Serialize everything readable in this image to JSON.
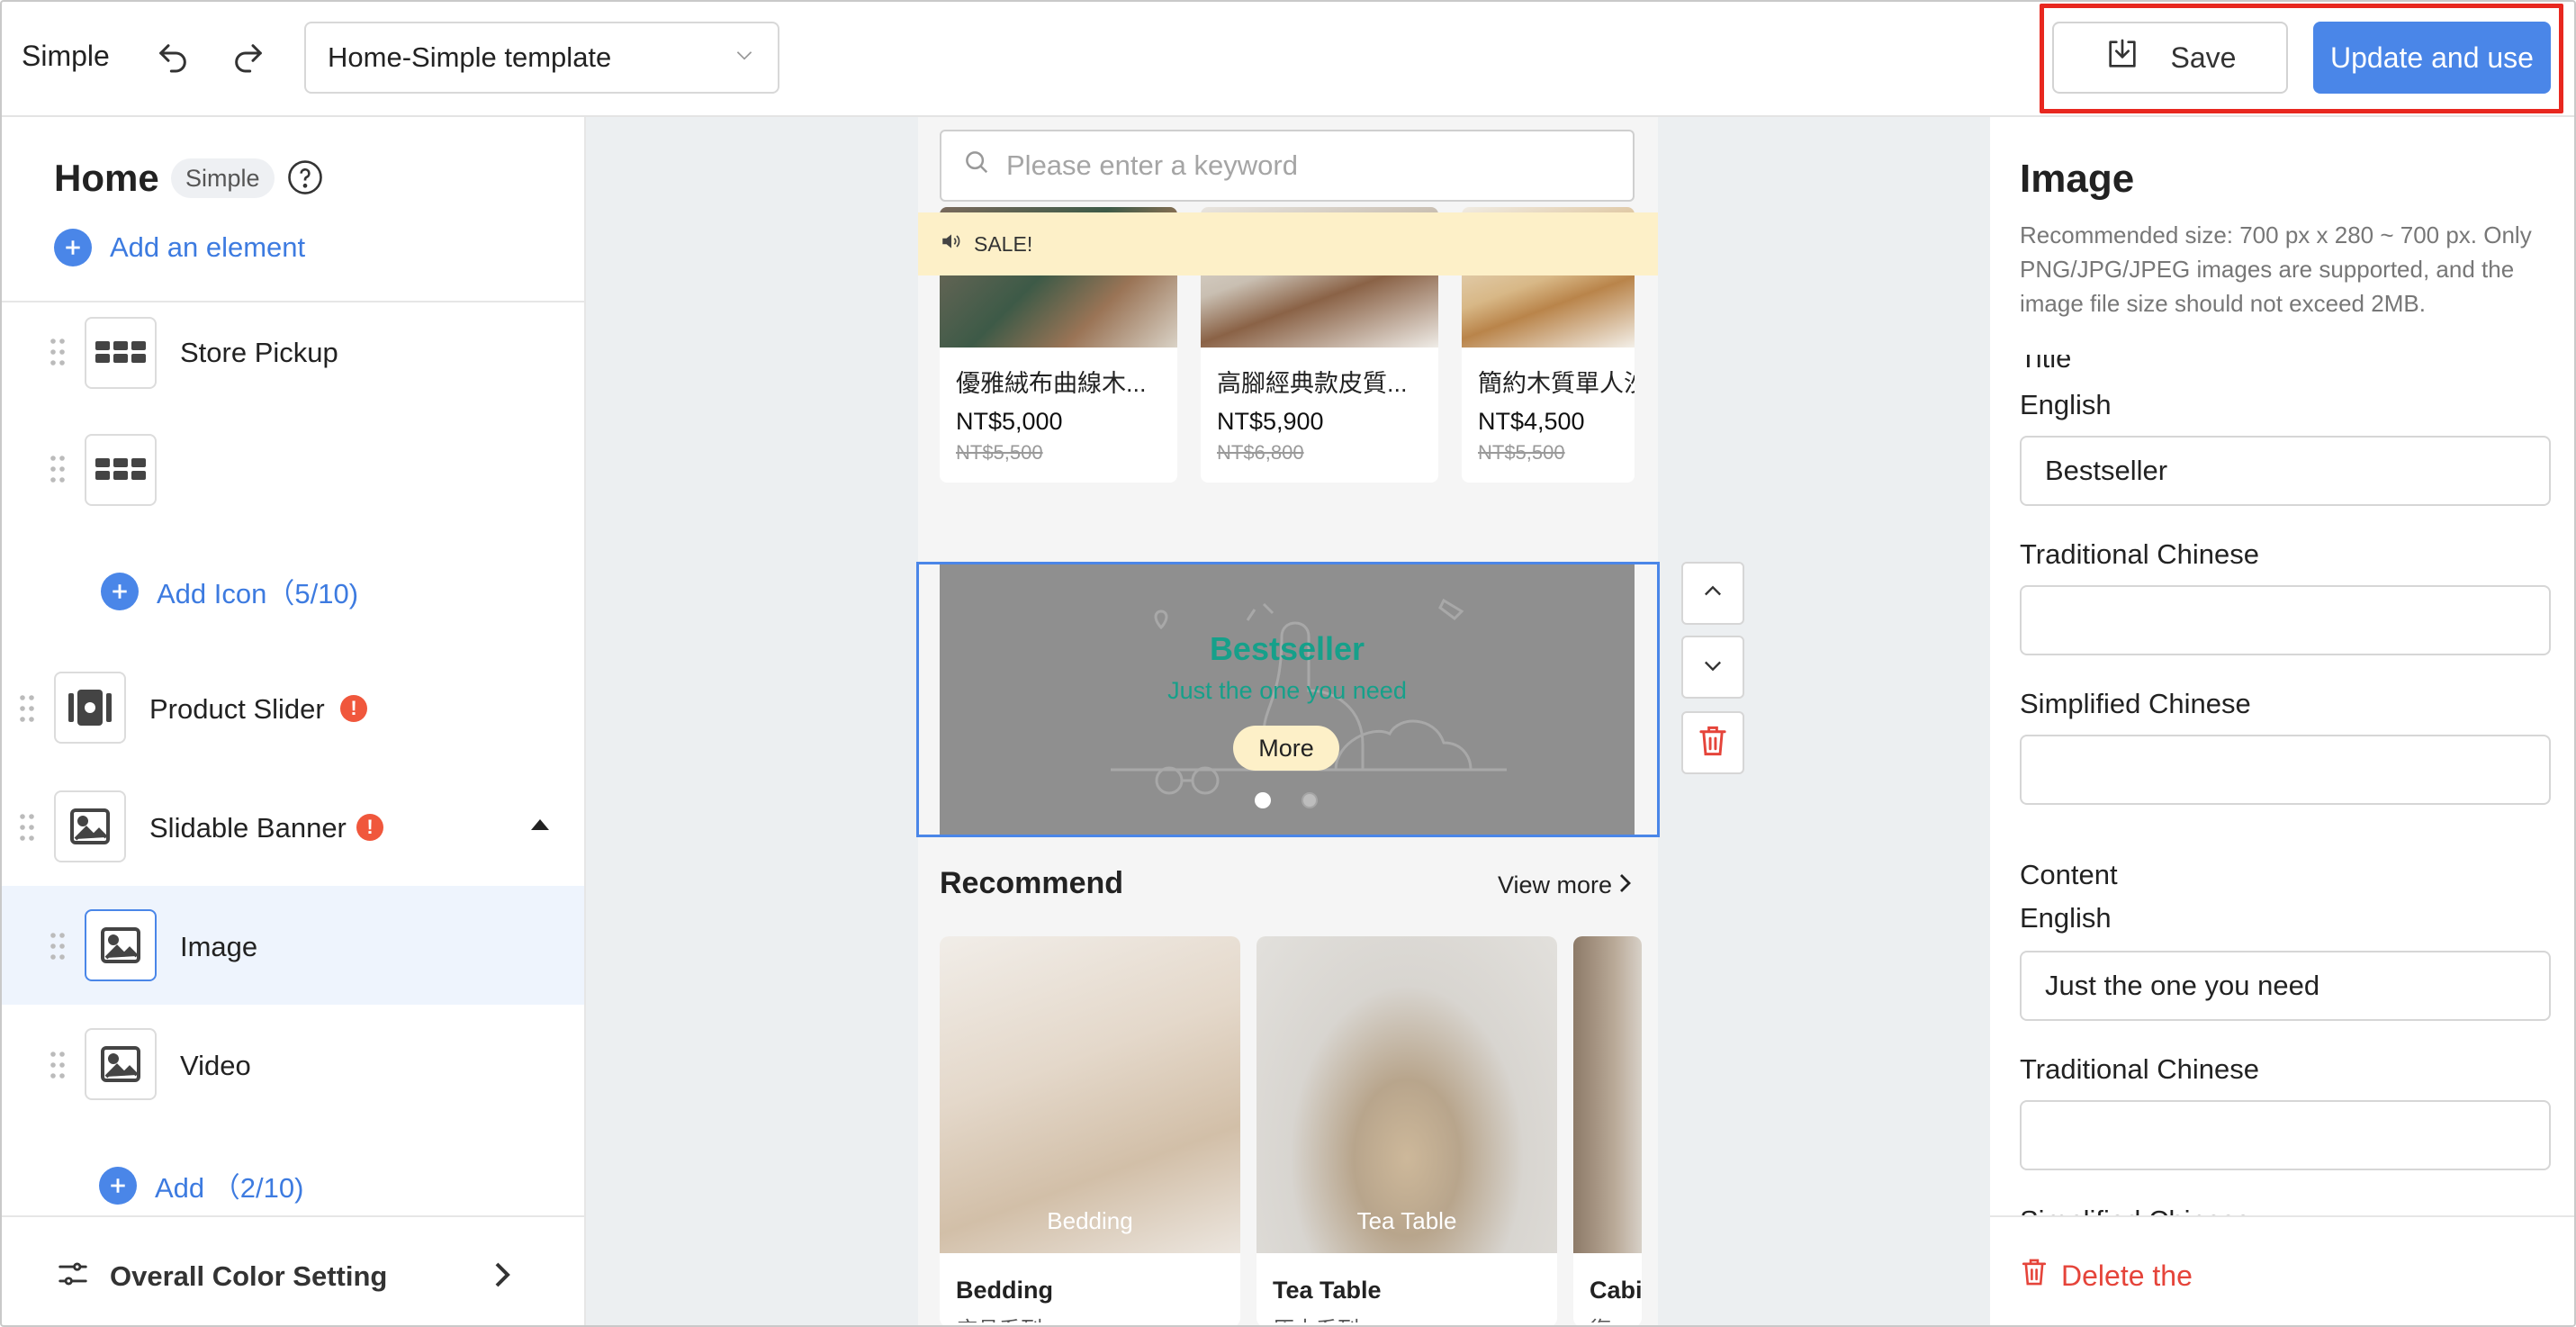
{
  "app": {
    "title": "Simple"
  },
  "toolbar": {
    "template_select": "Home-Simple template",
    "save_label": "Save",
    "update_label": "Update and use"
  },
  "left_panel": {
    "page_title": "Home",
    "badge": "Simple",
    "add_element": "Add an element",
    "items": [
      {
        "label": "Store Pickup"
      },
      {
        "label": ""
      },
      {
        "label": "Add Icon（5/10)"
      },
      {
        "label": "Product Slider"
      },
      {
        "label": "Slidable Banner"
      },
      {
        "label": "Image"
      },
      {
        "label": "Video"
      },
      {
        "label": "Add （2/10)"
      }
    ],
    "overall_color": "Overall Color Setting"
  },
  "preview": {
    "search_placeholder": "Please enter a keyword",
    "sale_text": "SALE!",
    "products": [
      {
        "name": "優雅絨布曲線木...",
        "price": "NT$5,000",
        "old_price": "NT$5,500"
      },
      {
        "name": "高腳經典款皮質...",
        "price": "NT$5,900",
        "old_price": "NT$6,800"
      },
      {
        "name": "簡約木質單人沙",
        "price": "NT$4,500",
        "old_price": "NT$5,500"
      }
    ],
    "banner": {
      "title": "Bestseller",
      "subtitle": "Just the one you need",
      "button": "More"
    },
    "recommend": {
      "title": "Recommend",
      "view_more": "View more",
      "cards": [
        {
          "caption": "Bedding",
          "name": "Bedding",
          "sub": "床具系列"
        },
        {
          "caption": "Tea Table",
          "name": "Tea Table",
          "sub": "原木系列"
        },
        {
          "caption": "",
          "name": "Cabi",
          "sub": "復古"
        }
      ]
    }
  },
  "right_panel": {
    "title": "Image",
    "help": "Recommended size: 700 px x 280 ~ 700 px. Only PNG/JPG/JPEG images are supported, and the image file size should not exceed 2MB.",
    "title_section": "Title",
    "english_label": "English",
    "english_value": "Bestseller",
    "trad_label": "Traditional Chinese",
    "trad_value": "",
    "simp_label": "Simplified Chinese",
    "simp_value": "",
    "content_section": "Content",
    "content_english_label": "English",
    "content_english_value": "Just the one you need",
    "content_trad_label": "Traditional Chinese",
    "content_trad_value": "",
    "content_simp_label": "Simplified Chinese",
    "delete_label": "Delete the"
  },
  "colors": {
    "accent": "#4a86e8",
    "highlight": "#e8271f",
    "banner_text": "#16a08a",
    "sale_bg": "#fdf0c8",
    "danger": "#e5443a"
  }
}
